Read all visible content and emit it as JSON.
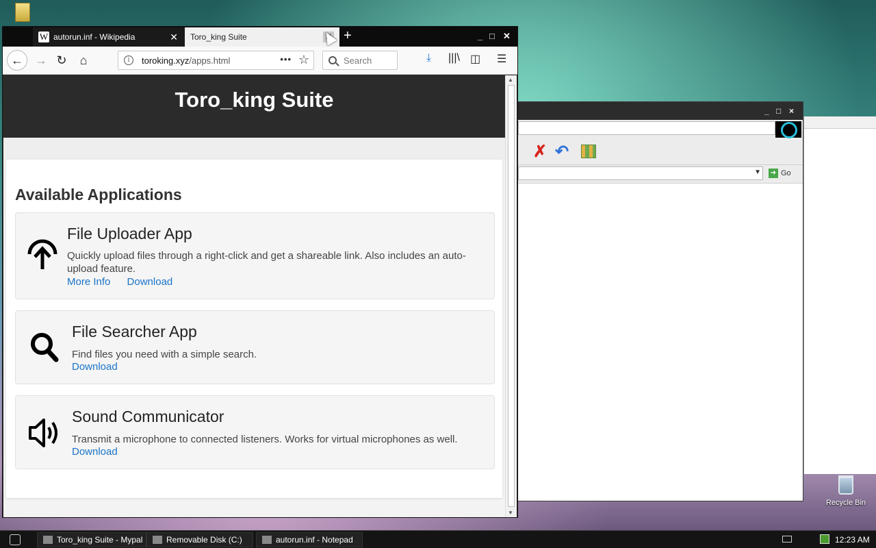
{
  "browser": {
    "tabs": [
      {
        "label": "autorun.inf - Wikipedia",
        "favicon": "W"
      },
      {
        "label": "Toro_king Suite"
      }
    ],
    "url_host": "toroking.xyz",
    "url_path": "/apps.html",
    "search_placeholder": "Search",
    "url_more": "•••"
  },
  "site": {
    "title": "Toro_king Suite",
    "section_title": "Available Applications",
    "apps": [
      {
        "name": "File Uploader App",
        "description": "Quickly upload files through a right-click and get a shareable link. Also includes an auto-upload feature.",
        "links": [
          "More Info",
          "Download"
        ]
      },
      {
        "name": "File Searcher App",
        "description": "Find files you need with a simple search.",
        "links": [
          "Download"
        ]
      },
      {
        "name": "Sound Communicator",
        "description": "Transmit a microphone to connected listeners. Works for virtual microphones as well.",
        "links": [
          "Download"
        ]
      }
    ]
  },
  "explorer": {
    "go_label": "Go"
  },
  "desktop": {
    "recycle_bin_label": "Recycle Bin"
  },
  "taskbar": {
    "items": [
      "Toro_king Suite - Mypal",
      "Removable Disk (C:)",
      "autorun.inf - Notepad"
    ],
    "clock": "12:23 AM"
  }
}
